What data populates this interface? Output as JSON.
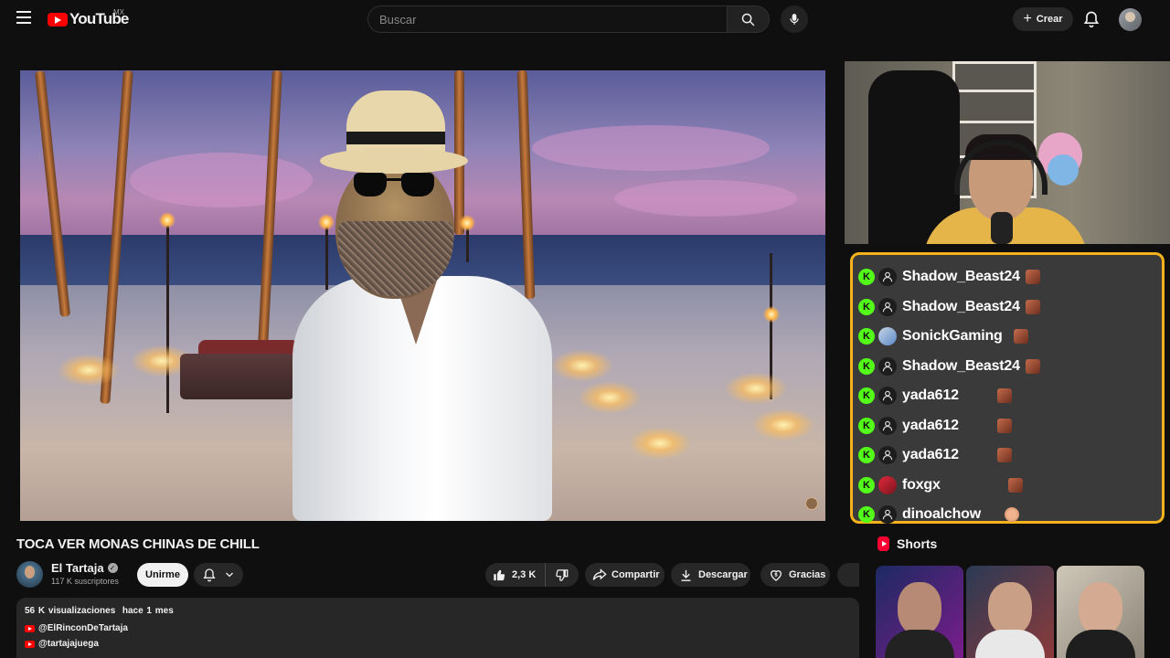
{
  "header": {
    "logo_text": "YouTube",
    "country_code": "MX",
    "search_placeholder": "Buscar",
    "create_label": "Crear"
  },
  "video": {
    "title": "TOCA VER MONAS CHINAS DE CHILL",
    "channel_name": "El Tartaja",
    "subscribers": "117 K suscriptores",
    "join_label": "Unirme",
    "likes": "2,3 K",
    "share_label": "Compartir",
    "download_label": "Descargar",
    "thanks_label": "Gracias"
  },
  "description": {
    "views": "56 K visualizaciones",
    "date": "hace 1 mes",
    "links": [
      "@ElRinconDeTartaja",
      "@tartajajuega"
    ]
  },
  "chat": {
    "badge_letter": "K",
    "accent_color": "#f5b21b",
    "badge_color": "#53fc18",
    "messages": [
      {
        "user": "Shadow_Beast24",
        "avatar": "default"
      },
      {
        "user": "Shadow_Beast24",
        "avatar": "default"
      },
      {
        "user": "SonickGaming",
        "avatar": "custom"
      },
      {
        "user": "Shadow_Beast24",
        "avatar": "default"
      },
      {
        "user": "yada612",
        "avatar": "default"
      },
      {
        "user": "yada612",
        "avatar": "default"
      },
      {
        "user": "yada612",
        "avatar": "default"
      },
      {
        "user": "foxgx",
        "avatar": "custom"
      },
      {
        "user": "dinoalchow",
        "avatar": "default"
      }
    ]
  },
  "shorts": {
    "heading": "Shorts"
  }
}
